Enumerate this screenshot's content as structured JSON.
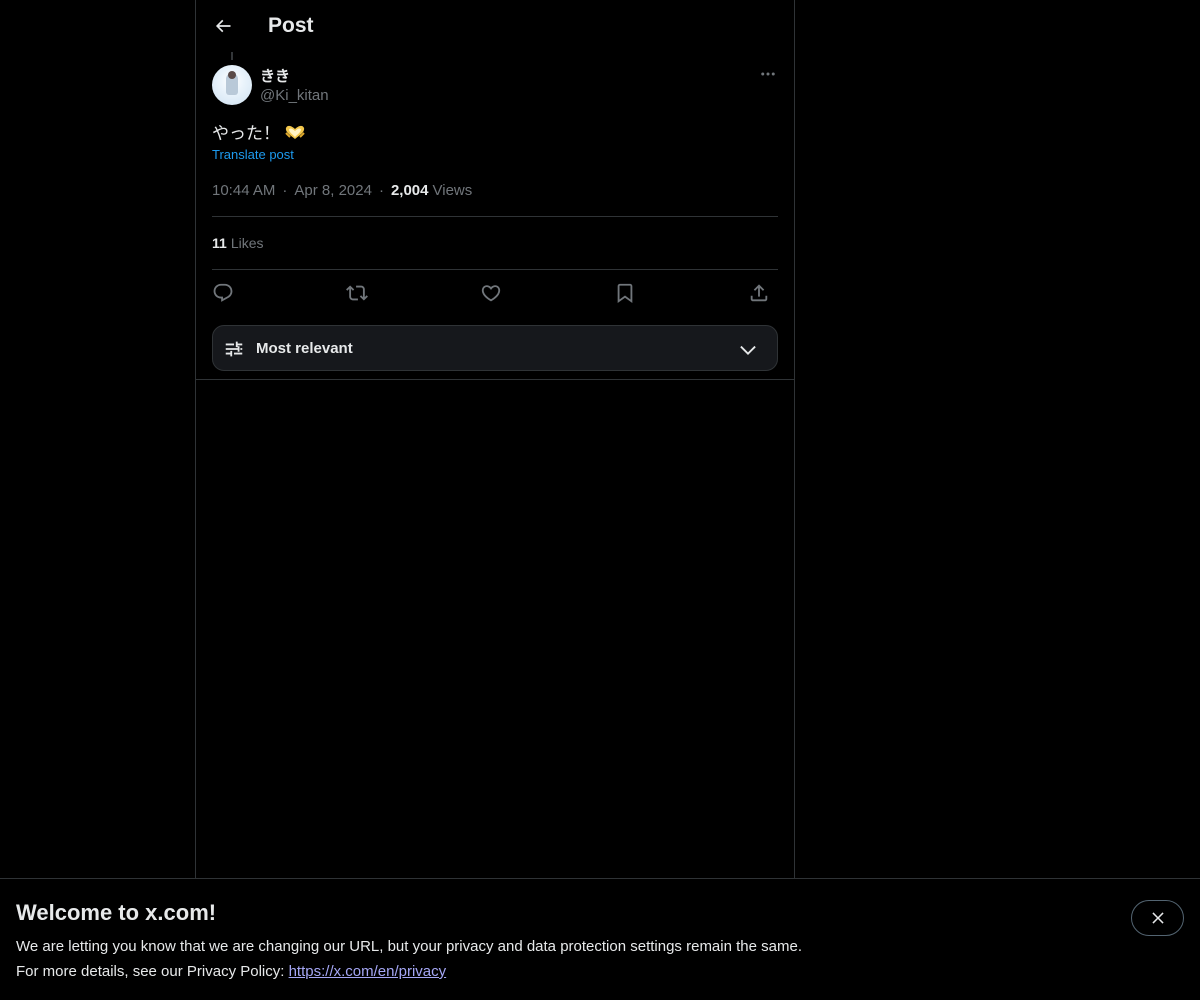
{
  "header": {
    "title": "Post"
  },
  "post": {
    "display_name": "きき",
    "handle": "@Ki_kitan",
    "text": "やった！",
    "emoji_name": "heart-hands-icon",
    "translate_label": "Translate post",
    "time": "10:44 AM",
    "date": "Apr 8, 2024",
    "views_count": "2,004",
    "views_label": "Views",
    "dot": "·",
    "likes_count": "11",
    "likes_label": "Likes"
  },
  "actions": [
    "reply-icon",
    "repost-icon",
    "like-icon",
    "bookmark-icon",
    "share-icon"
  ],
  "sort": {
    "label": "Most relevant"
  },
  "banner": {
    "title": "Welcome to x.com!",
    "line1": "We are letting you know that we are changing our URL, but your privacy and data protection settings remain the same.",
    "line2_prefix": "For more details, see our Privacy Policy: ",
    "link": "https://x.com/en/privacy"
  },
  "colors": {
    "background": "#000000",
    "text": "#e7e9ea",
    "secondary": "#71767b",
    "accent": "#1d9bf0",
    "border": "#2f3336"
  }
}
